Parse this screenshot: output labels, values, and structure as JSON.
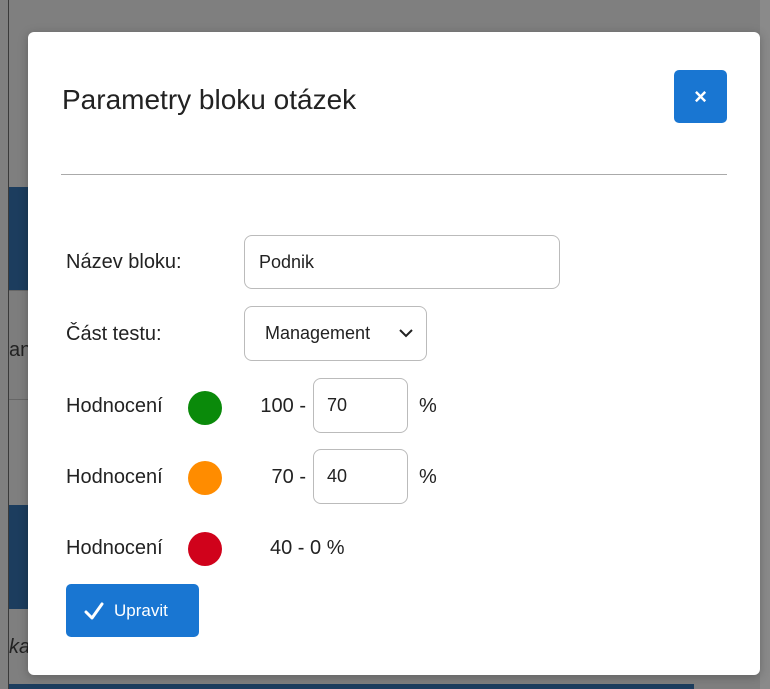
{
  "background": {
    "fragment_1": "an",
    "fragment_2": "ka"
  },
  "modal": {
    "title": "Parametry bloku otázek",
    "close_label": "×",
    "name_label": "Název bloku:",
    "name_value": "Podnik",
    "section_label": "Část testu:",
    "section_selected": "Management",
    "ratings": [
      {
        "label": "Hodnocení",
        "color": "#0a8a0a",
        "upper": "100 -",
        "input_value": "70",
        "unit": "%"
      },
      {
        "label": "Hodnocení",
        "color": "#ff8c00",
        "upper": "70 -",
        "input_value": "40",
        "unit": "%"
      },
      {
        "label": "Hodnocení",
        "color": "#d0021b",
        "range_text": "40 - 0 %"
      }
    ],
    "submit_label": "Upravit"
  },
  "colors": {
    "primary": "#1976d2",
    "green": "#0a8a0a",
    "orange": "#ff8c00",
    "red": "#d0021b"
  }
}
